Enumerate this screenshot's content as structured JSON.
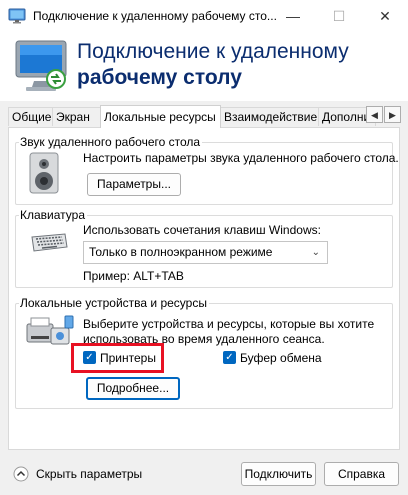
{
  "window": {
    "title": "Подключение к удаленному рабочему сто...",
    "minimize_glyph": "—",
    "maximize_glyph": "☐",
    "close_glyph": "✕"
  },
  "banner": {
    "line1": "Подключение к удаленному",
    "line2": "рабочему столу",
    "icon": "remote-desktop-icon"
  },
  "tabs": [
    {
      "label": "Общие",
      "active": false
    },
    {
      "label": "Экран",
      "active": false
    },
    {
      "label": "Локальные ресурсы",
      "active": true
    },
    {
      "label": "Взаимодействие",
      "active": false
    },
    {
      "label": "Дополнит",
      "active": false
    }
  ],
  "tab_scroll": {
    "left": "◀",
    "right": "▶"
  },
  "sound": {
    "group_label": "Звук удаленного рабочего стола",
    "description": "Настроить параметры звука удаленного рабочего стола.",
    "button": "Параметры...",
    "icon": "speaker-icon"
  },
  "keyboard": {
    "group_label": "Клавиатура",
    "description": "Использовать сочетания клавиш Windows:",
    "selected_option": "Только в полноэкранном режиме",
    "example": "Пример: ALT+TAB",
    "icon": "keyboard-icon"
  },
  "devices": {
    "group_label": "Локальные устройства и ресурсы",
    "description_line1": "Выберите устройства и ресурсы, которые вы хотите",
    "description_line2": "использовать во время удаленного сеанса.",
    "printers_label": "Принтеры",
    "printers_checked": true,
    "clipboard_label": "Буфер обмена",
    "clipboard_checked": true,
    "more_button": "Подробнее...",
    "icon": "devices-icon",
    "highlight_color": "#e81123"
  },
  "footer": {
    "toggle_label": "Скрыть параметры",
    "connect_button": "Подключить",
    "help_button": "Справка"
  },
  "colors": {
    "accent": "#0067c0",
    "banner_text": "#0b2d6f"
  }
}
